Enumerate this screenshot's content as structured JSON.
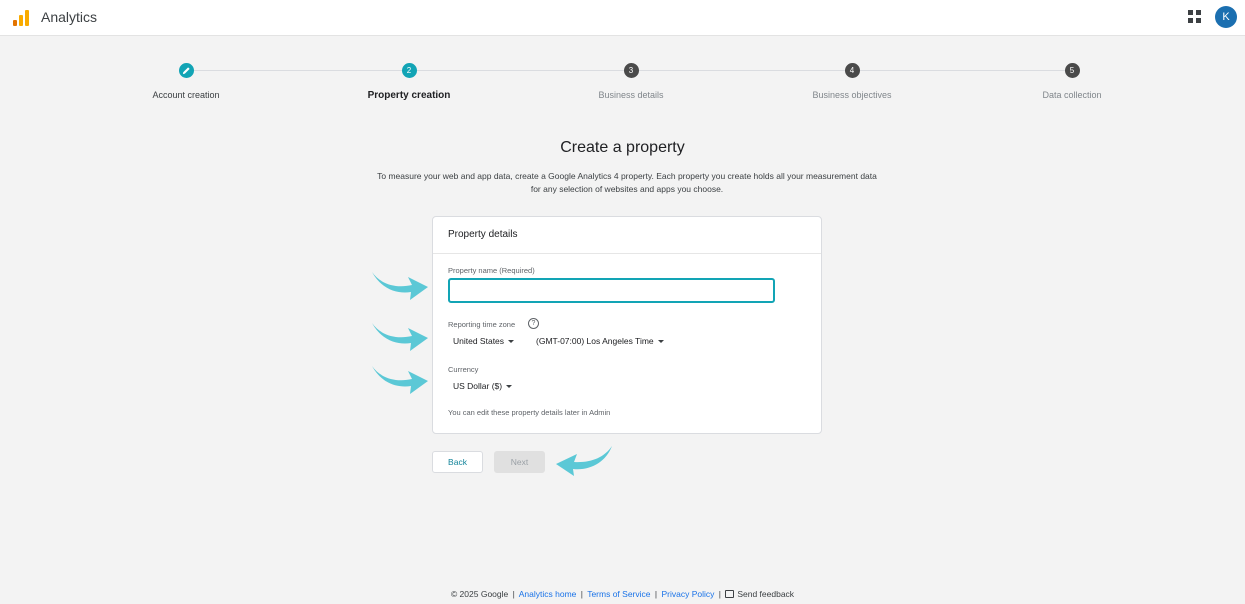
{
  "app": {
    "title": "Analytics",
    "avatar_letter": "K",
    "logo_icon": "analytics-bar-logo",
    "apps_icon": "apps-grid-icon"
  },
  "stepper": {
    "steps": [
      {
        "label": "Account creation",
        "marker": "",
        "state": "done",
        "icon": "pencil-icon"
      },
      {
        "label": "Property creation",
        "marker": "2",
        "state": "active"
      },
      {
        "label": "Business details",
        "marker": "3",
        "state": "todo"
      },
      {
        "label": "Business objectives",
        "marker": "4",
        "state": "todo"
      },
      {
        "label": "Data collection",
        "marker": "5",
        "state": "todo"
      }
    ]
  },
  "main": {
    "title": "Create a property",
    "description": "To measure your web and app data, create a Google Analytics 4 property. Each property you create holds all your measurement data for any selection of websites and apps you choose."
  },
  "card": {
    "header": "Property details",
    "property_name_label": "Property name (Required)",
    "property_name_value": "",
    "timezone_label": "Reporting time zone",
    "help_icon_glyph": "?",
    "country": "United States",
    "timezone": "(GMT-07:00) Los Angeles Time",
    "currency_label": "Currency",
    "currency": "US Dollar ($)",
    "note": "You can edit these property details later in Admin"
  },
  "buttons": {
    "back": "Back",
    "next": "Next"
  },
  "footer": {
    "copyright": "© 2025 Google",
    "sep": "|",
    "analytics_home": "Analytics home",
    "terms": "Terms of Service",
    "privacy": "Privacy Policy",
    "feedback": "Send feedback"
  },
  "colors": {
    "accent": "#12a4b5",
    "annotation_arrow": "#5bc8d6",
    "link": "#1a73e8",
    "logo_orange": "#f9ab00",
    "logo_dark_orange": "#e37400"
  }
}
